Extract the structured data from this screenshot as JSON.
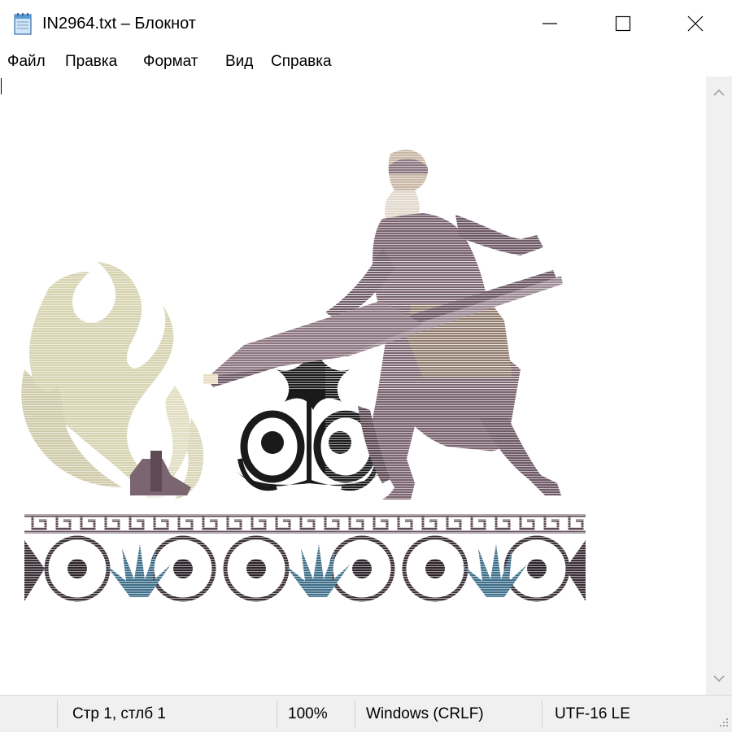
{
  "window": {
    "title": "IN2964.txt – Блокнот",
    "app_icon": "notepad-icon",
    "controls": {
      "minimize": "minimize-icon",
      "maximize": "maximize-icon",
      "close": "close-icon"
    }
  },
  "menu": {
    "items": [
      {
        "label": "Файл"
      },
      {
        "label": "Правка"
      },
      {
        "label": "Формат"
      },
      {
        "label": "Вид"
      },
      {
        "label": "Справка"
      }
    ]
  },
  "editor": {
    "content": "ascii-art-image",
    "content_colors": {
      "figure": "#6e5a66",
      "flame": "#d6d3b0",
      "ornament": "#1a1a1a",
      "leaf": "#3f6f8a"
    }
  },
  "statusbar": {
    "position": "Стр 1, стлб 1",
    "zoom": "100%",
    "line_endings": "Windows (CRLF)",
    "encoding": "UTF-16 LE"
  },
  "colors": {
    "chrome": "#f0f0f0",
    "background": "#ffffff",
    "text": "#000000"
  }
}
